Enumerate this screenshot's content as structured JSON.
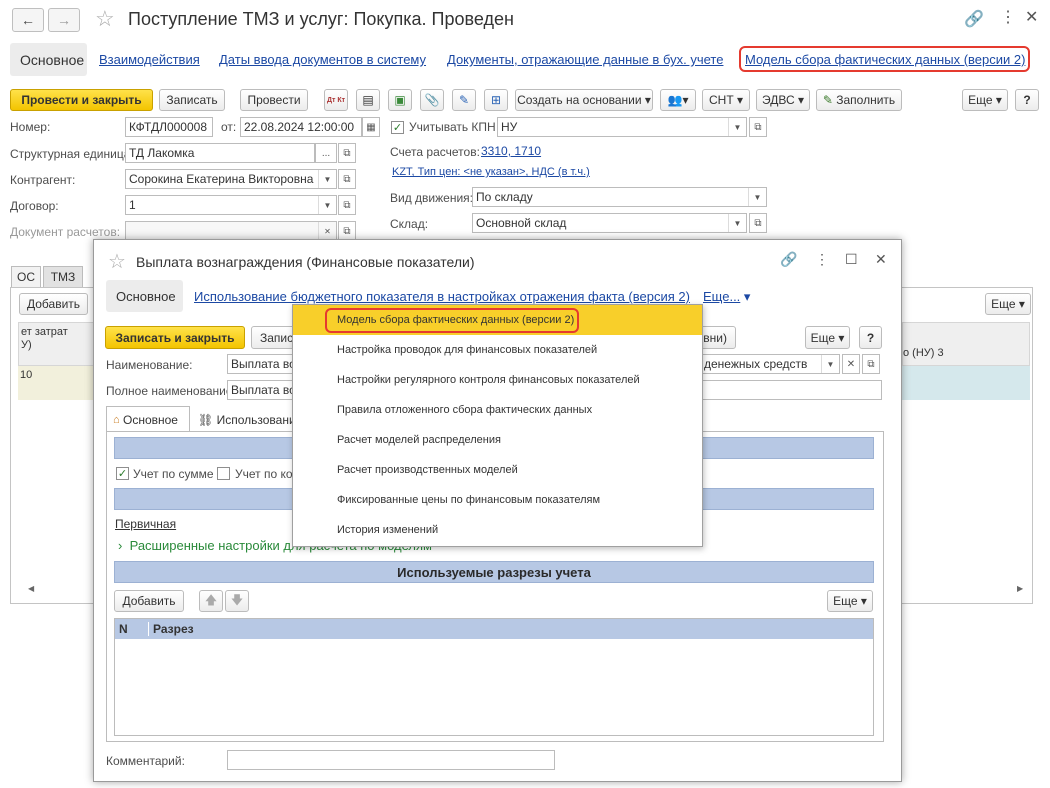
{
  "main": {
    "title": "Поступление ТМЗ и услуг: Покупка. Проведен",
    "nav_tabs": [
      "Основное",
      "Взаимодействия",
      "Даты ввода документов в систему",
      "Документы, отражающие данные в бух. учете",
      "Модель сбора фактических данных (версии 2)"
    ],
    "toolbar": {
      "post_close": "Провести и закрыть",
      "save": "Записать",
      "post": "Провести",
      "dtkt": "Дт Кт",
      "create_based": "Создать на основании",
      "snt": "СНТ",
      "edvs": "ЭДВС",
      "fill": "Заполнить",
      "more": "Еще",
      "help": "?"
    },
    "fields": {
      "number_label": "Номер:",
      "number": "КФТДЛ000008",
      "from_label": "от:",
      "date": "22.08.2024 12:00:00",
      "kpn_label": "Учитывать КПН",
      "kpn_value": "НУ",
      "unit_label": "Структурная единица:",
      "unit": "ТД Лакомка",
      "contractor_label": "Контрагент:",
      "contractor": "Сорокина Екатерина Викторовна",
      "contract_label": "Договор:",
      "contract": "1",
      "doc_label": "Документ расчетов:",
      "accounts_label": "Счета расчетов:",
      "accounts": "3310, 1710",
      "price_info": "KZT, Тип цен: <не указан>, НДС (в т.ч.)",
      "movement_label": "Вид движения:",
      "movement": "По складу",
      "warehouse_label": "Склад:",
      "warehouse": "Основной склад"
    },
    "bottom_tabs": [
      "ОС",
      "ТМЗ"
    ],
    "add": "Добавить",
    "more": "Еще",
    "table": {
      "col1a": "ет затрат",
      "col1b": "У)",
      "col_right": "о (НУ) 3",
      "row_val": "10"
    }
  },
  "dialog": {
    "title": "Выплата вознаграждения (Финансовые показатели)",
    "tab_main": "Основное",
    "tab_link": "Использование бюджетного показателя в настройках отражения факта (версия 2)",
    "tab_more": "Еще...",
    "save_close": "Записать и закрыть",
    "save_partial": "Запис",
    "hidden_btn": "вни)",
    "more": "Еще",
    "help": "?",
    "name_label": "Наименование:",
    "name_value": "Выплата воз",
    "name_right": "денежных средств",
    "fullname_label": "Полное наименование:",
    "fullname_value": "Выплата воз",
    "inner_tab1": "Основное",
    "inner_tab2": "Использовани",
    "sum_label": "Учет по сумме",
    "qty_label": "Учет по кол",
    "primary_link": "Первичная",
    "extended": "Расширенные настройки для расчета по моделям",
    "sections_bar": "Используемые разрезы учета",
    "add": "Добавить",
    "more2": "Еще",
    "grid_cols": [
      "N",
      "Разрез"
    ],
    "comment_label": "Комментарий:"
  },
  "menu": {
    "items": [
      "Модель сбора фактических данных (версии 2)",
      "Настройка проводок для финансовых показателей",
      "Настройки регулярного контроля финансовых показателей",
      "Правила отложенного сбора фактических данных",
      "Расчет моделей распределения",
      "Расчет производственных моделей",
      "Фиксированные цены по финансовым показателям",
      "История изменений"
    ]
  },
  "colors": {
    "accent_yellow": "#f3c400",
    "link": "#1c49a4",
    "highlight_red": "#e53a2f",
    "bar_blue": "#b7c8e4"
  }
}
